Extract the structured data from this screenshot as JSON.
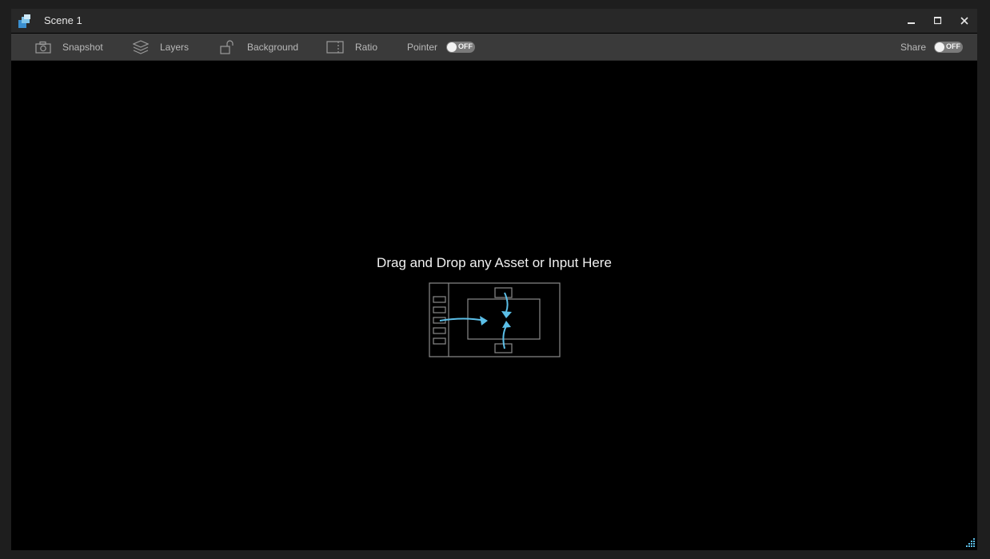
{
  "window": {
    "title": "Scene 1"
  },
  "titlebar": {
    "minimize_icon": "minimize-icon",
    "maximize_icon": "maximize-icon",
    "close_icon": "close-icon"
  },
  "toolbar": {
    "snapshot": {
      "label": "Snapshot",
      "icon": "camera-icon"
    },
    "layers": {
      "label": "Layers",
      "icon": "layers-icon"
    },
    "background": {
      "label": "Background",
      "icon": "unlock-icon"
    },
    "ratio": {
      "label": "Ratio",
      "icon": "ratio-icon"
    },
    "pointer": {
      "label": "Pointer",
      "toggle": "OFF"
    },
    "share": {
      "label": "Share",
      "toggle": "OFF"
    }
  },
  "dropzone": {
    "text": "Drag and Drop any Asset or Input Here",
    "accent": "#5bbfe8"
  }
}
